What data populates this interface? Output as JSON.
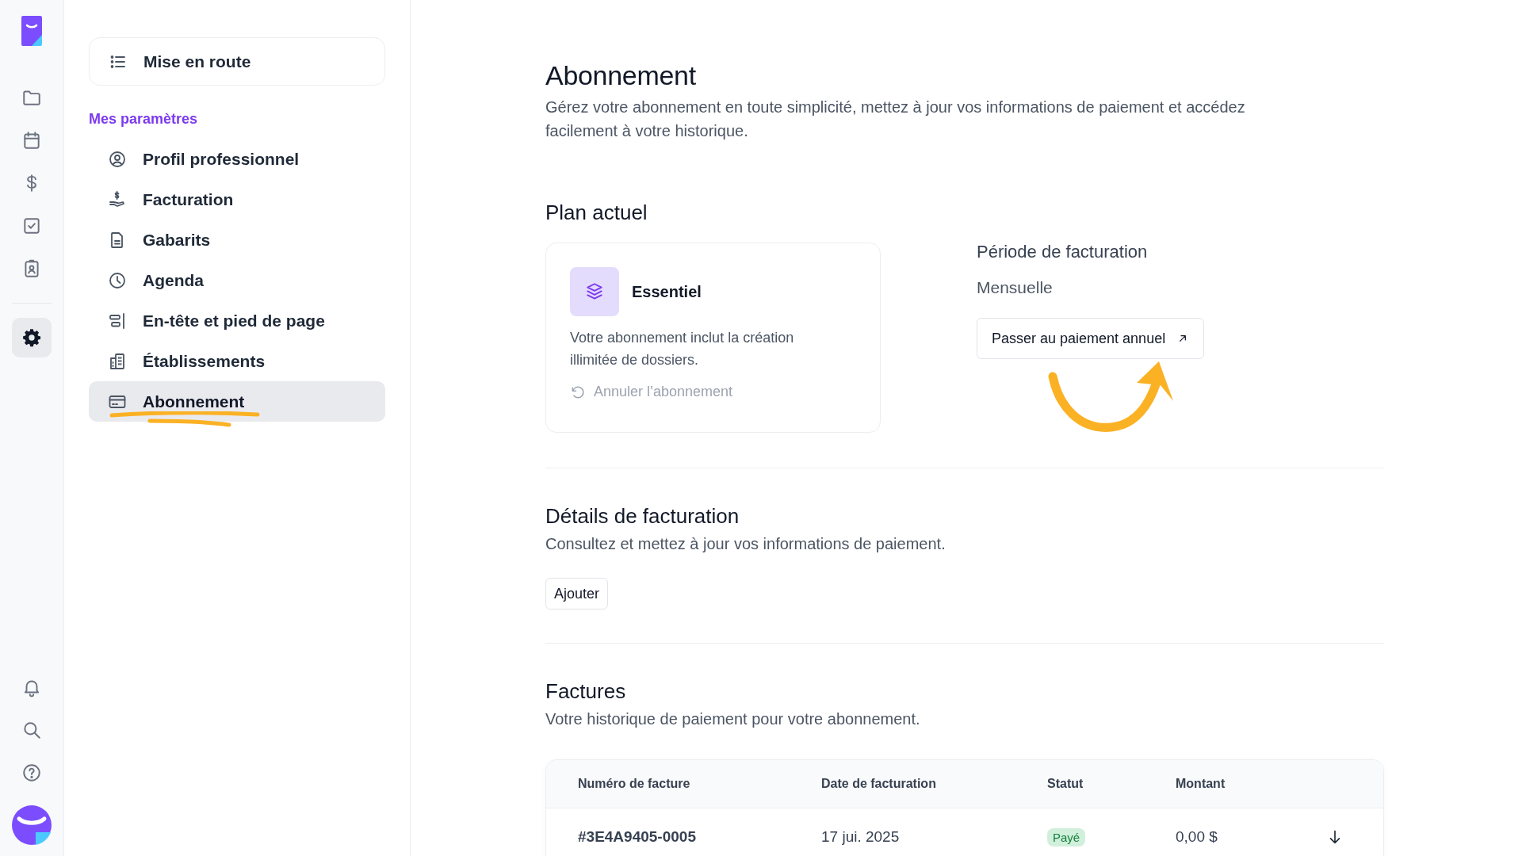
{
  "rail": {
    "items": [
      {
        "kind": "folder",
        "selected": false
      },
      {
        "kind": "calendar",
        "selected": false
      },
      {
        "kind": "dollar",
        "selected": false
      },
      {
        "kind": "checkbox",
        "selected": false
      },
      {
        "kind": "badge",
        "selected": false
      },
      {
        "kind": "settings",
        "selected": true
      }
    ],
    "bottom": [
      {
        "kind": "bell"
      },
      {
        "kind": "search"
      },
      {
        "kind": "help"
      }
    ]
  },
  "sidebar": {
    "start": {
      "label": "Mise en route"
    },
    "section": "Mes paramètres",
    "items": [
      {
        "kind": "profile",
        "label": "Profil professionnel",
        "selected": false
      },
      {
        "kind": "billing",
        "label": "Facturation",
        "selected": false
      },
      {
        "kind": "document",
        "label": "Gabarits",
        "selected": false
      },
      {
        "kind": "clock",
        "label": "Agenda",
        "selected": false
      },
      {
        "kind": "layout",
        "label": "En-tête et pied de page",
        "selected": false
      },
      {
        "kind": "building",
        "label": "Établissements",
        "selected": false
      },
      {
        "kind": "card",
        "label": "Abonnement",
        "selected": true
      }
    ]
  },
  "page": {
    "title": "Abonnement",
    "description": "Gérez votre abonnement en toute simplicité, mettez à jour vos informations de paiement et accédez facilement à votre historique."
  },
  "plan": {
    "heading": "Plan actuel",
    "name": "Essentiel",
    "description": "Votre abonnement inclut la création illimitée de dossiers.",
    "cancel": "Annuler l’abonnement",
    "period_label": "Période de facturation",
    "period": "Mensuelle",
    "upgrade_button": "Passer au paiement annuel"
  },
  "billing": {
    "heading": "Détails de facturation",
    "description": "Consultez et mettez à jour vos informations de paiement.",
    "add_button": "Ajouter"
  },
  "invoices": {
    "heading": "Factures",
    "description": "Votre historique de paiement pour votre abonnement.",
    "columns": [
      "Numéro de facture",
      "Date de facturation",
      "Statut",
      "Montant"
    ],
    "rows": [
      {
        "number": "#3E4A9405-0005",
        "date": "17 jui. 2025",
        "status": "Payé",
        "color": "#d1f0dc",
        "amount": "0,00 $"
      }
    ]
  }
}
